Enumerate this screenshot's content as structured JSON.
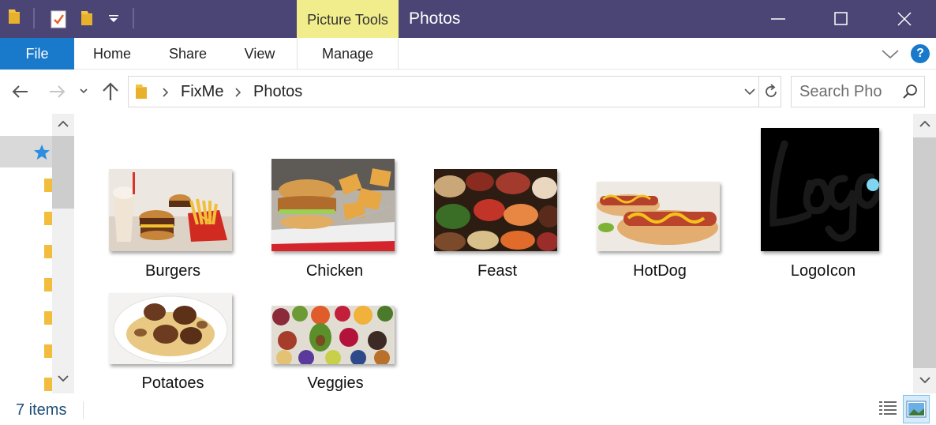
{
  "window": {
    "title": "Photos",
    "contextual_tab_group": "Picture Tools"
  },
  "ribbon": {
    "tabs": [
      "File",
      "Home",
      "Share",
      "View",
      "Manage"
    ],
    "help_label": "?"
  },
  "address_bar": {
    "breadcrumb": [
      "FixMe",
      "Photos"
    ]
  },
  "search": {
    "placeholder": "Search Pho"
  },
  "files": [
    {
      "name": "Burgers",
      "thumbnail": "burgers-photo"
    },
    {
      "name": "Chicken",
      "thumbnail": "chicken-photo"
    },
    {
      "name": "Feast",
      "thumbnail": "feast-photo"
    },
    {
      "name": "HotDog",
      "thumbnail": "hotdog-photo"
    },
    {
      "name": "LogoIcon",
      "thumbnail": "logo-image"
    },
    {
      "name": "Potatoes",
      "thumbnail": "potatoes-photo"
    },
    {
      "name": "Veggies",
      "thumbnail": "veggies-photo"
    }
  ],
  "status": {
    "item_count": "7 items"
  },
  "colors": {
    "titlebar": "#4a4575",
    "picture_tools": "#f1ec8c",
    "file_tab": "#1979ca",
    "status_text": "#1e4e79"
  }
}
